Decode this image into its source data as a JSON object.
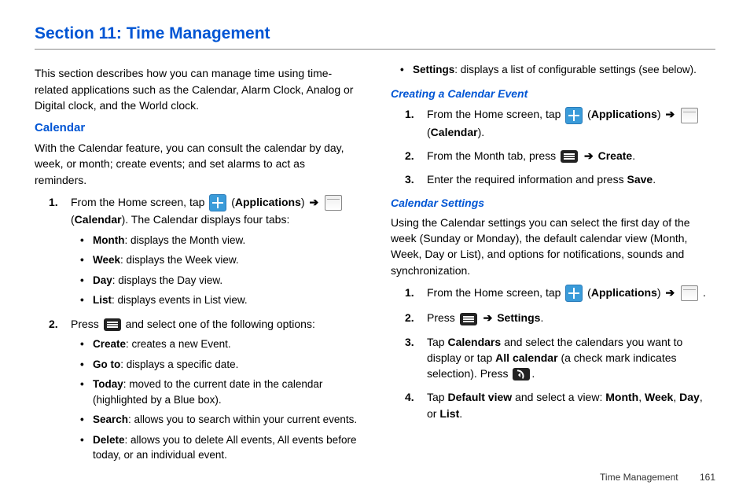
{
  "title": "Section 11: Time Management",
  "intro": "This section describes how you can manage time using time-related applications such as the Calendar, Alarm Clock, Analog or Digital clock, and the World clock.",
  "calendar": {
    "heading": "Calendar",
    "intro": "With the Calendar feature, you can consult the calendar by day, week, or month; create events; and set alarms to act as reminders.",
    "step1_a": "From the Home screen, tap",
    "step1_b": "(",
    "step1_apps": "Applications",
    "step1_c": ")",
    "step1_d": "(",
    "step1_cal": "Calendar",
    "step1_e": "). The Calendar displays four tabs:",
    "tabs": [
      {
        "name": "Month",
        "desc": ": displays the Month view."
      },
      {
        "name": "Week",
        "desc": ": displays the Week view."
      },
      {
        "name": "Day",
        "desc": ": displays the Day view."
      },
      {
        "name": "List",
        "desc": ": displays events in List view."
      }
    ],
    "step2_a": "Press",
    "step2_b": "and select one of the following options:",
    "opts": [
      {
        "name": "Create",
        "desc": ": creates a new Event."
      },
      {
        "name": "Go to",
        "desc": ": displays a specific date."
      },
      {
        "name": "Today",
        "desc": ": moved to the current date in the calendar (highlighted by a Blue box)."
      },
      {
        "name": "Search",
        "desc": ": allows you to search within your current events."
      },
      {
        "name": "Delete",
        "desc": ": allows you to delete All events, All events before today, or an individual event."
      }
    ]
  },
  "right_top_bullet": {
    "name": "Settings",
    "desc": ": displays a list of configurable settings (see below)."
  },
  "creating": {
    "heading": "Creating a Calendar Event",
    "step1_a": "From the Home screen, tap",
    "step1_apps": "Applications",
    "step1_cal": "Calendar",
    "step2_a": "From the Month tab, press",
    "step2_b": "Create",
    "step3": "Enter the required information and press",
    "step3_b": "Save"
  },
  "settings": {
    "heading": "Calendar Settings",
    "intro": "Using the Calendar settings you can select the first day of the week (Sunday or Monday), the default calendar view (Month, Week, Day or List), and options for notifications, sounds and synchronization.",
    "step1_a": "From the Home screen, tap",
    "step1_apps": "Applications",
    "step2_a": "Press",
    "step2_b": "Settings",
    "step3_a": "Tap",
    "step3_b": "Calendars",
    "step3_c": "and select the calendars you want to display or tap",
    "step3_d": "All calendar",
    "step3_e": "(a check mark indicates selection). Press",
    "step4_a": "Tap",
    "step4_b": "Default view",
    "step4_c": "and select a view:",
    "views": [
      "Month",
      "Week",
      "Day",
      "List"
    ]
  },
  "footer": {
    "label": "Time Management",
    "page": "161"
  }
}
